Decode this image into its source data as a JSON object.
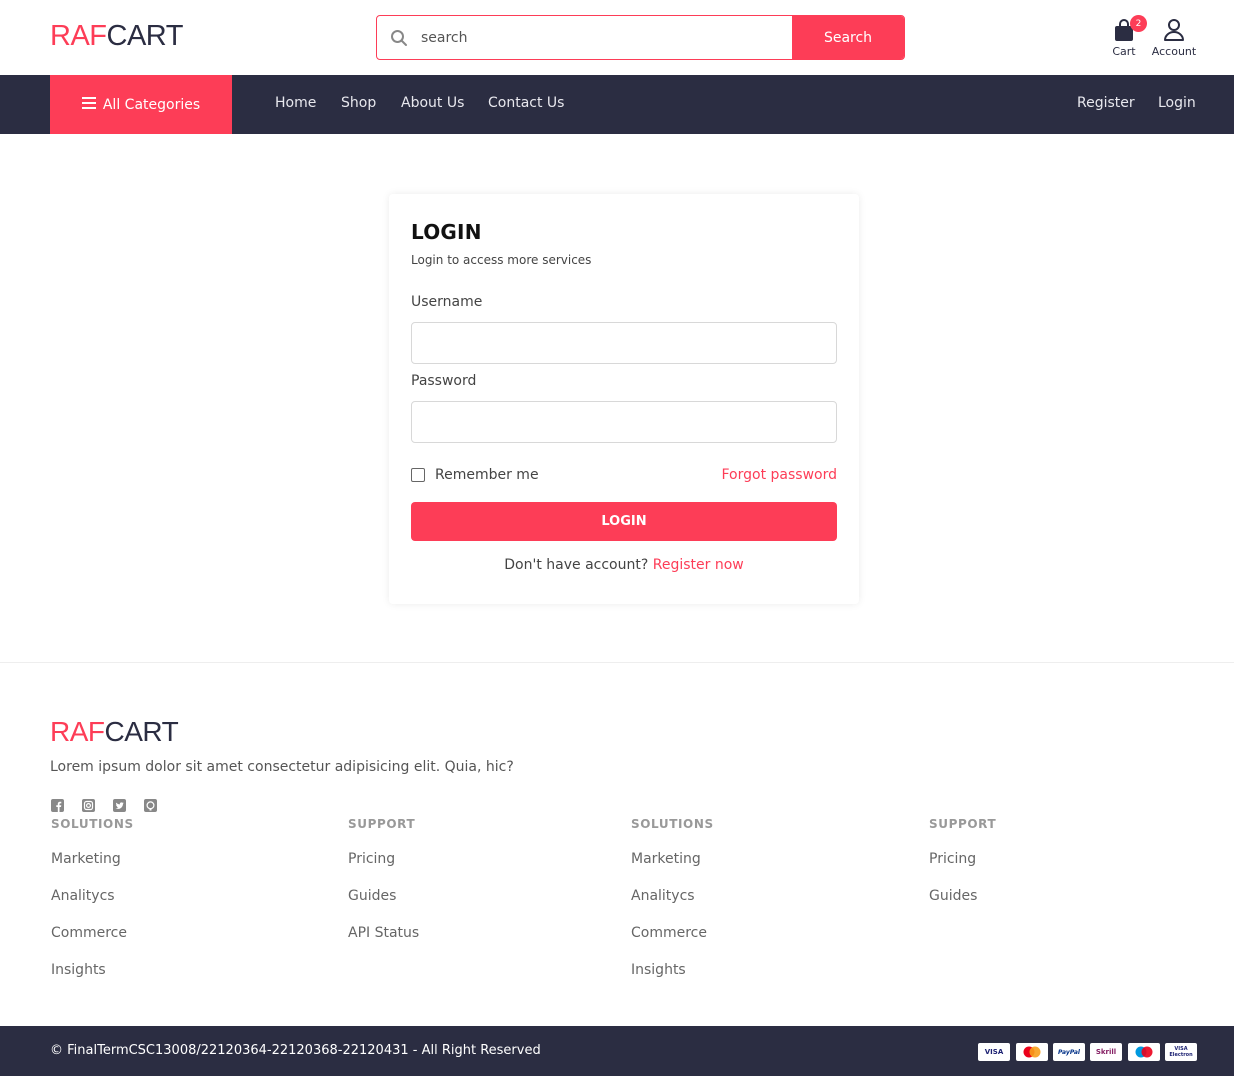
{
  "header": {
    "logo_accent": "RAF",
    "logo_main": "CART",
    "search_placeholder": "search",
    "search_button": "Search",
    "cart_label": "Cart",
    "cart_count": "2",
    "account_label": "Account"
  },
  "nav": {
    "all_categories": "All Categories",
    "links": [
      "Home",
      "Shop",
      "About Us",
      "Contact Us"
    ],
    "register": "Register",
    "login": "Login"
  },
  "login_card": {
    "title": "LOGIN",
    "subtitle": "Login to access more services",
    "username_label": "Username",
    "password_label": "Password",
    "remember_label": "Remember me",
    "forgot_label": "Forgot password",
    "submit_label": "LOGIN",
    "no_account_text": "Don't have account?",
    "register_link": "Register now"
  },
  "footer": {
    "logo_accent": "RAF",
    "logo_main": "CART",
    "description": "Lorem ipsum dolor sit amet consectetur adipisicing elit. Quia, hic?",
    "social_icons": [
      "facebook-icon",
      "instagram-icon",
      "twitter-icon",
      "github-icon"
    ],
    "columns": [
      {
        "heading": "SOLUTIONS",
        "items": [
          "Marketing",
          "Analitycs",
          "Commerce",
          "Insights"
        ]
      },
      {
        "heading": "SUPPORT",
        "items": [
          "Pricing",
          "Guides",
          "API Status"
        ]
      },
      {
        "heading": "SOLUTIONS",
        "items": [
          "Marketing",
          "Analitycs",
          "Commerce",
          "Insights"
        ]
      },
      {
        "heading": "SUPPORT",
        "items": [
          "Pricing",
          "Guides"
        ]
      }
    ],
    "copyright": "© FinalTermCSC13008/22120364-22120368-22120431 - All Right Reserved",
    "payment_methods": [
      "VISA",
      "Mastercard",
      "PayPal",
      "Skrill",
      "Maestro",
      "VISA Electron"
    ]
  },
  "colors": {
    "accent": "#fd3d57",
    "dark": "#2b2d42"
  }
}
